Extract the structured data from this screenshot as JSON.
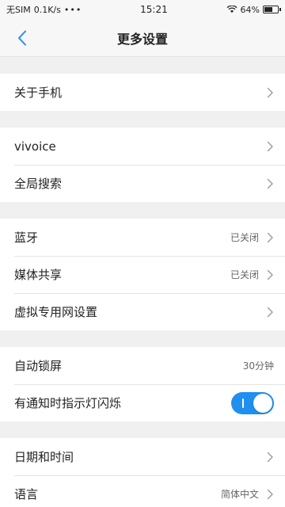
{
  "statusbar": {
    "carrier": "无SIM",
    "speed": "0.1K/s",
    "dots": "•••",
    "time": "15:21",
    "battery": "64%",
    "battery_level": 0.64
  },
  "header": {
    "title": "更多设置"
  },
  "groups": [
    {
      "items": [
        {
          "label": "关于手机"
        }
      ]
    },
    {
      "items": [
        {
          "label": "vivoice"
        },
        {
          "label": "全局搜索"
        }
      ]
    },
    {
      "items": [
        {
          "label": "蓝牙",
          "value": "已关闭"
        },
        {
          "label": "媒体共享",
          "value": "已关闭"
        },
        {
          "label": "虚拟专用网设置"
        }
      ]
    },
    {
      "items": [
        {
          "label": "自动锁屏",
          "value": "30分钟"
        },
        {
          "label": "有通知时指示灯闪烁",
          "toggle": true
        }
      ]
    },
    {
      "items": [
        {
          "label": "日期和时间"
        },
        {
          "label": "语言",
          "value": "简体中文"
        }
      ]
    }
  ],
  "colors": {
    "accent": "#1f8ff0",
    "background": "#f0f0f0"
  }
}
